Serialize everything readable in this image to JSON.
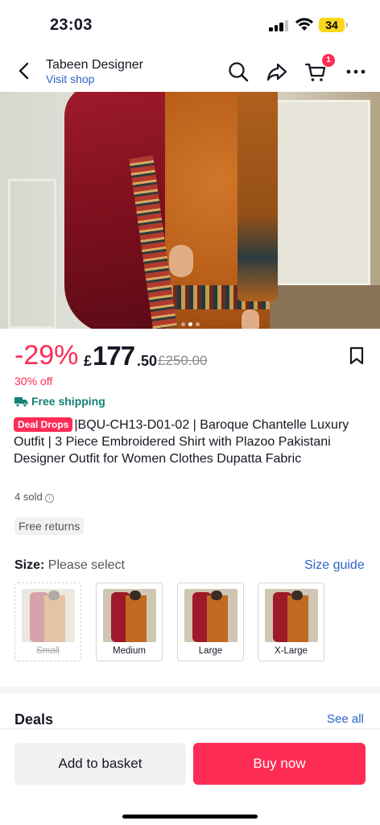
{
  "status_bar": {
    "time": "23:03",
    "battery": "34"
  },
  "header": {
    "shop_name": "Tabeen Designer",
    "visit_shop": "Visit shop",
    "cart_count": "1"
  },
  "price": {
    "discount": "-29%",
    "currency": "£",
    "integer": "177",
    "decimal": ".50",
    "original": "£250.00",
    "off_label": "30% off",
    "shipping": "Free shipping"
  },
  "product": {
    "badge": "Deal Drops",
    "title": "|BQU-CH13-D01-02 | Baroque Chantelle Luxury Outfit | 3 Piece Embroidered Shirt with Plazoo Pakistani Designer Outfit for Women Clothes Dupatta Fabric",
    "sold": "4 sold",
    "returns": "Free returns"
  },
  "size": {
    "label": "Size:",
    "hint": "Please select",
    "guide": "Size guide",
    "options": [
      {
        "label": "Small",
        "available": false
      },
      {
        "label": "Medium",
        "available": true
      },
      {
        "label": "Large",
        "available": true
      },
      {
        "label": "X-Large",
        "available": true
      }
    ]
  },
  "deals": {
    "title": "Deals",
    "see_all": "See all"
  },
  "actions": {
    "add_to_basket": "Add to basket",
    "buy_now": "Buy now"
  },
  "gallery": {
    "total": 3,
    "current": 2
  },
  "colors": {
    "accent": "#fe2c55",
    "link": "#2c63c9",
    "shipping": "#128273"
  }
}
